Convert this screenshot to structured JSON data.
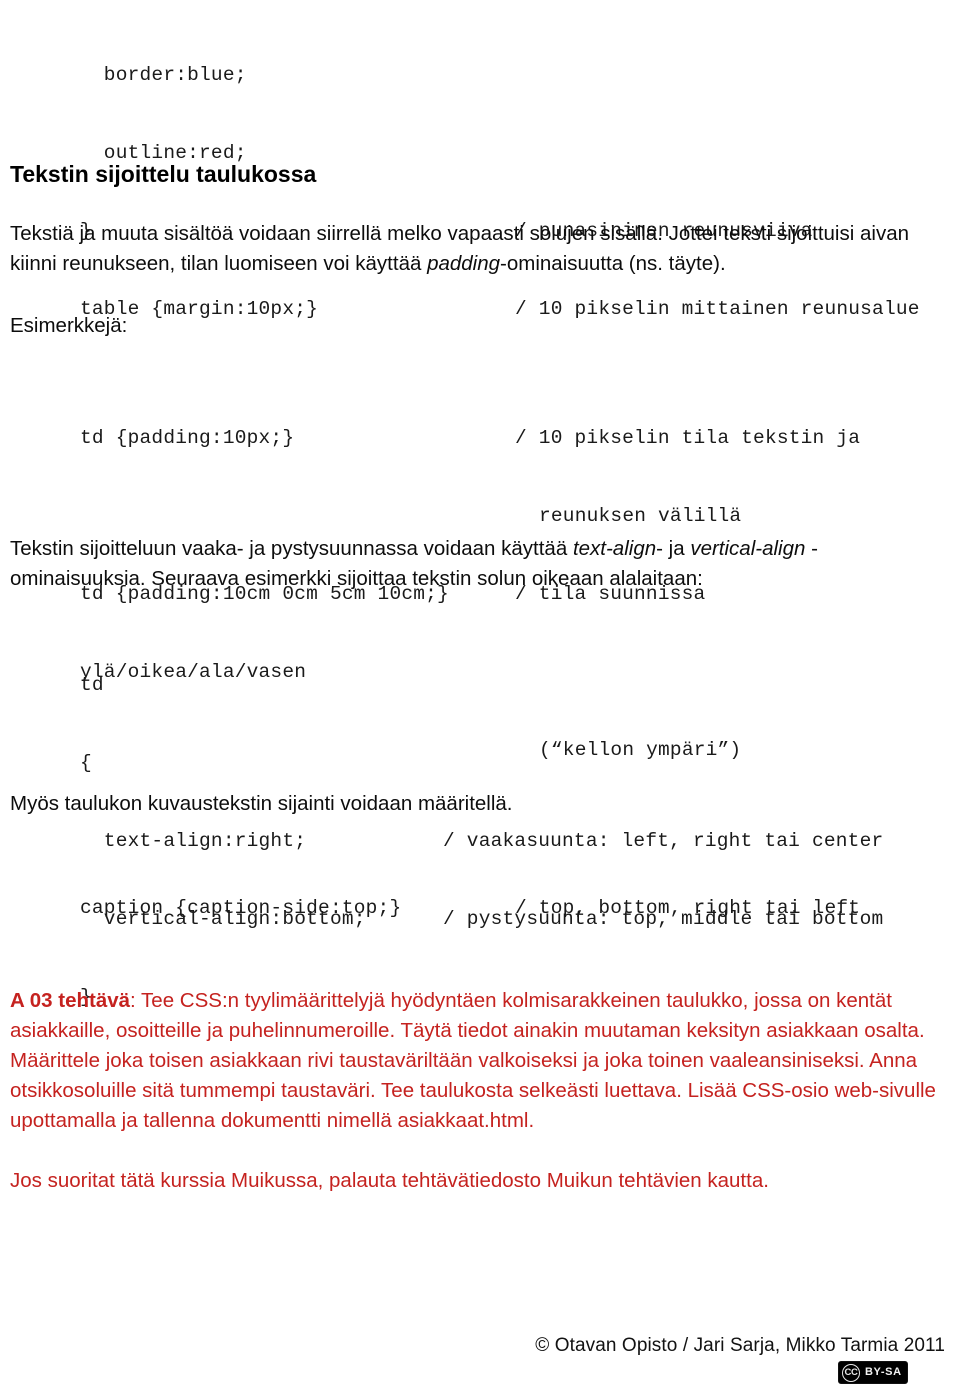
{
  "document": {
    "top_code_block": {
      "lines": [
        {
          "code": "  border:blue;",
          "comment": ""
        },
        {
          "code": "  outline:red;",
          "comment": ""
        },
        {
          "code": "}",
          "comment": "/ punasininen reunusviiva"
        },
        {
          "code": "table {margin:10px;}",
          "comment": "/ 10 pikselin mittainen reunusalue"
        }
      ]
    },
    "heading": "Tekstin sijoittelu taulukossa",
    "intro_paragraph": {
      "part1": "Tekstiä ja muuta sisältöä voidaan siirrellä melko vapaasti solujen sisällä. Jottei teksti sijoittuisi aivan kiinni reunukseen, tilan luomiseen voi käyttää ",
      "emphasis": "padding",
      "part2": "-ominaisuutta (ns. täyte)."
    },
    "examples_label": "Esimerkkejä:",
    "padding_code_block": {
      "line1_code": "td {padding:10px;}",
      "line1_comment": "/ 10 pikselin tila tekstin ja",
      "line1_comment_cont": "reunuksen välillä",
      "line2_code": "td {padding:10cm 0cm 5cm 10cm;}",
      "line2_comment": "/ tila suunnissa",
      "line3_code": "ylä/oikea/ala/vasen",
      "line3_comment": "(“kellon ympäri”)"
    },
    "align_paragraph": {
      "part1": "Tekstin sijoitteluun vaaka- ja pystysuunnassa voidaan käyttää ",
      "emphasis1": "text-align",
      "part2": "- ja ",
      "emphasis2": "vertical-align",
      "part3": " -ominaisuuksia. Seuraava esimerkki sijoittaa tekstin solun oikeaan alalaitaan:"
    },
    "align_code_block": {
      "lines": [
        {
          "code": "td",
          "comment": ""
        },
        {
          "code": "{",
          "comment": ""
        },
        {
          "code": "  text-align:right;",
          "comment": "/ vaakasuunta: left, right tai center"
        },
        {
          "code": "  vertical-align:bottom;",
          "comment": "/ pystysuunta: top, middle tai bottom"
        },
        {
          "code": "}",
          "comment": ""
        }
      ]
    },
    "caption_paragraph": "Myös taulukon kuvaustekstin sijainti voidaan määritellä.",
    "caption_code_block": {
      "code": "caption {caption-side:top;}",
      "comment": "/ top, bottom, right tai left"
    },
    "assignment": {
      "color": "#C5221F",
      "label": "A 03 tehtävä",
      "body": ": Tee CSS:n tyylimäärittelyjä hyödyntäen kolmisarakkeinen taulukko, jossa on kentät asiakkaille, osoitteille ja puhelinnumeroille. Täytä tiedot ainakin muutaman keksityn asiakkaan osalta. Määrittele joka toisen asiakkaan rivi taustaväriltään valkoiseksi ja joka toinen vaaleansiniseksi. Anna otsikkosoluille sitä tummempi taustaväri. Tee taulukosta selkeästi luettava. Lisää CSS-osio web-sivulle upottamalla ja tallenna dokumentti nimellä asiakkaat.html.",
      "note": "Jos suoritat tätä kurssia Muikussa, palauta tehtävätiedosto Muikun tehtävien kautta."
    },
    "footer": {
      "copyright": "© Otavan Opisto / Jari Sarja, Mikko Tarmia 2011",
      "license_mark": "CC",
      "license_label": "BY-SA"
    }
  }
}
